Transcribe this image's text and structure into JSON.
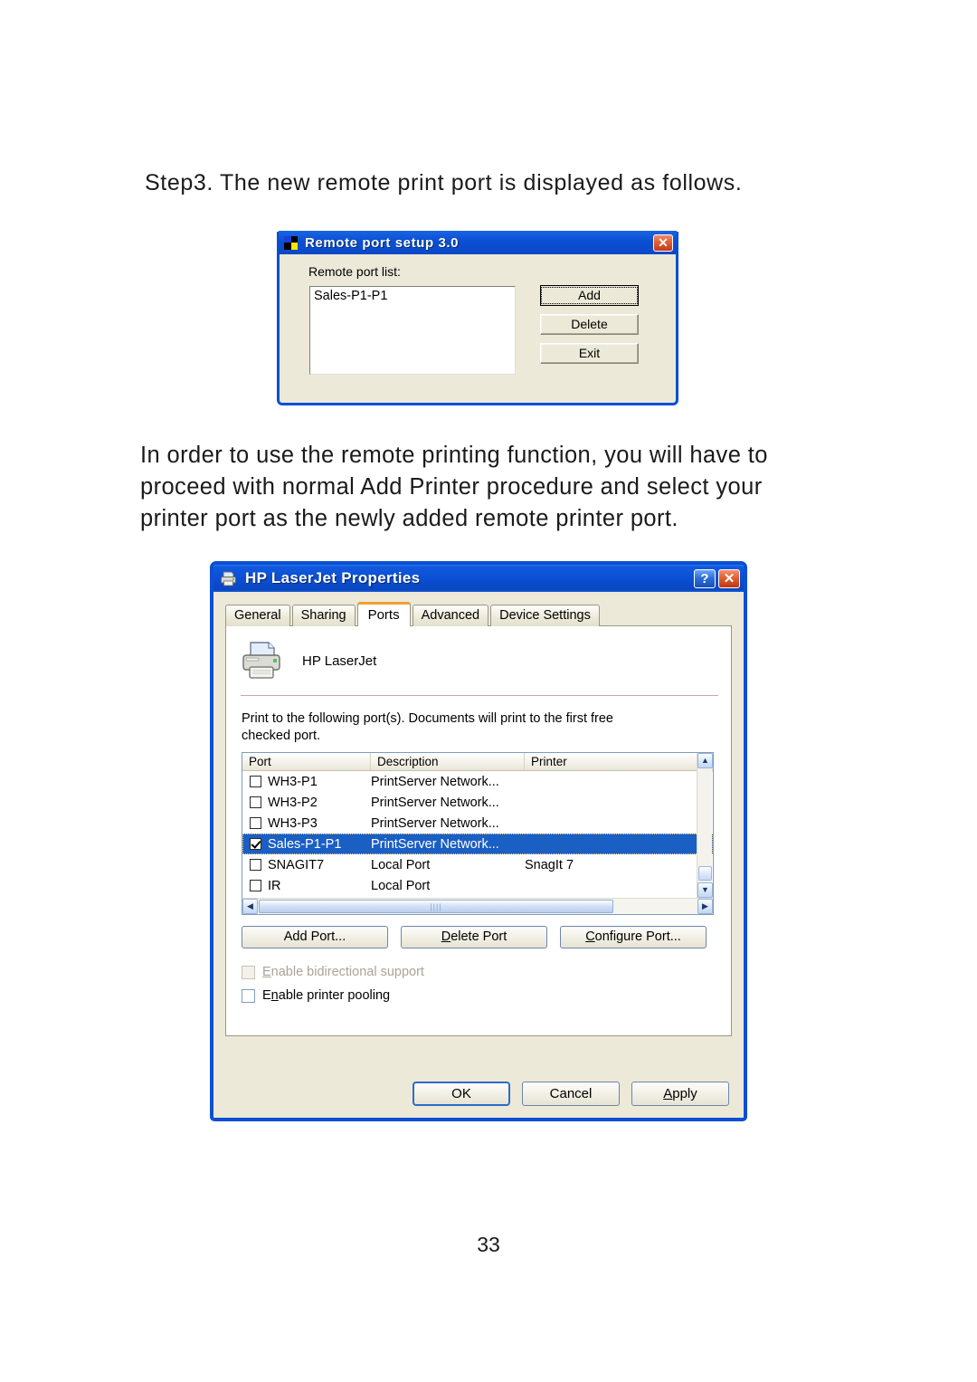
{
  "document": {
    "heading": "Step3. The new remote print port is displayed as follows.",
    "paragraph": "In order to use the remote printing function, you will have to proceed with normal Add Printer procedure and select your printer port as the newly added remote printer port.",
    "page_number": "33"
  },
  "remote_port_setup": {
    "title": "Remote port setup 3.0",
    "close_label": "✕",
    "list_label": "Remote port list:",
    "ports": [
      "Sales-P1-P1"
    ],
    "buttons": {
      "add": "Add",
      "delete": "Delete",
      "exit": "Exit"
    }
  },
  "printer_properties": {
    "title": "HP LaserJet Properties",
    "help_label": "?",
    "close_label": "✕",
    "tabs": [
      {
        "label": "General",
        "active": false
      },
      {
        "label": "Sharing",
        "active": false
      },
      {
        "label": "Ports",
        "active": true
      },
      {
        "label": "Advanced",
        "active": false
      },
      {
        "label": "Device Settings",
        "active": false
      }
    ],
    "printer_name": "HP LaserJet",
    "description_line1": "Print to the following port(s). Documents will print to the first free",
    "description_line2": "checked port.",
    "description_accesskey": "P",
    "table": {
      "headers": [
        "Port",
        "Description",
        "Printer"
      ],
      "rows": [
        {
          "checked": false,
          "port": "WH3-P1",
          "description": "PrintServer Network...",
          "printer": "",
          "selected": false
        },
        {
          "checked": false,
          "port": "WH3-P2",
          "description": "PrintServer Network...",
          "printer": "",
          "selected": false
        },
        {
          "checked": false,
          "port": "WH3-P3",
          "description": "PrintServer Network...",
          "printer": "",
          "selected": false
        },
        {
          "checked": true,
          "port": "Sales-P1-P1",
          "description": "PrintServer Network...",
          "printer": "",
          "selected": true
        },
        {
          "checked": false,
          "port": "SNAGIT7",
          "description": "Local Port",
          "printer": "SnagIt 7",
          "selected": false
        },
        {
          "checked": false,
          "port": "IR",
          "description": "Local Port",
          "printer": "",
          "selected": false
        }
      ]
    },
    "scroll": {
      "up_arrow": "▲",
      "down_arrow": "▼",
      "left_arrow": "◀",
      "right_arrow": "▶",
      "grip": "||||"
    },
    "port_buttons": {
      "add_port": "Add Port...",
      "add_port_pre": "Add Por",
      "add_port_key": "t",
      "add_port_post": "...",
      "delete_port_key": "D",
      "delete_port_post": "elete Port",
      "configure_port_pre": "",
      "configure_port_key": "C",
      "configure_port_mid": "onfi",
      "configure_port_key2": "g",
      "configure_port_post": "ure Port..."
    },
    "checkboxes": {
      "bidirectional_key": "E",
      "bidirectional_post": "nable bidirectional support",
      "bidirectional_checked": false,
      "bidirectional_enabled": false,
      "pooling_pre": "E",
      "pooling_key": "n",
      "pooling_post": "able printer pooling",
      "pooling_checked": false
    },
    "footer_buttons": {
      "ok": "OK",
      "cancel": "Cancel",
      "apply_key": "A",
      "apply_post": "pply"
    }
  },
  "colors": {
    "title_blue": "#0b4fd4",
    "dialog_face": "#ece9d8",
    "selection_blue": "#1a5fc4",
    "tab_accent_orange": "#f0a030"
  }
}
